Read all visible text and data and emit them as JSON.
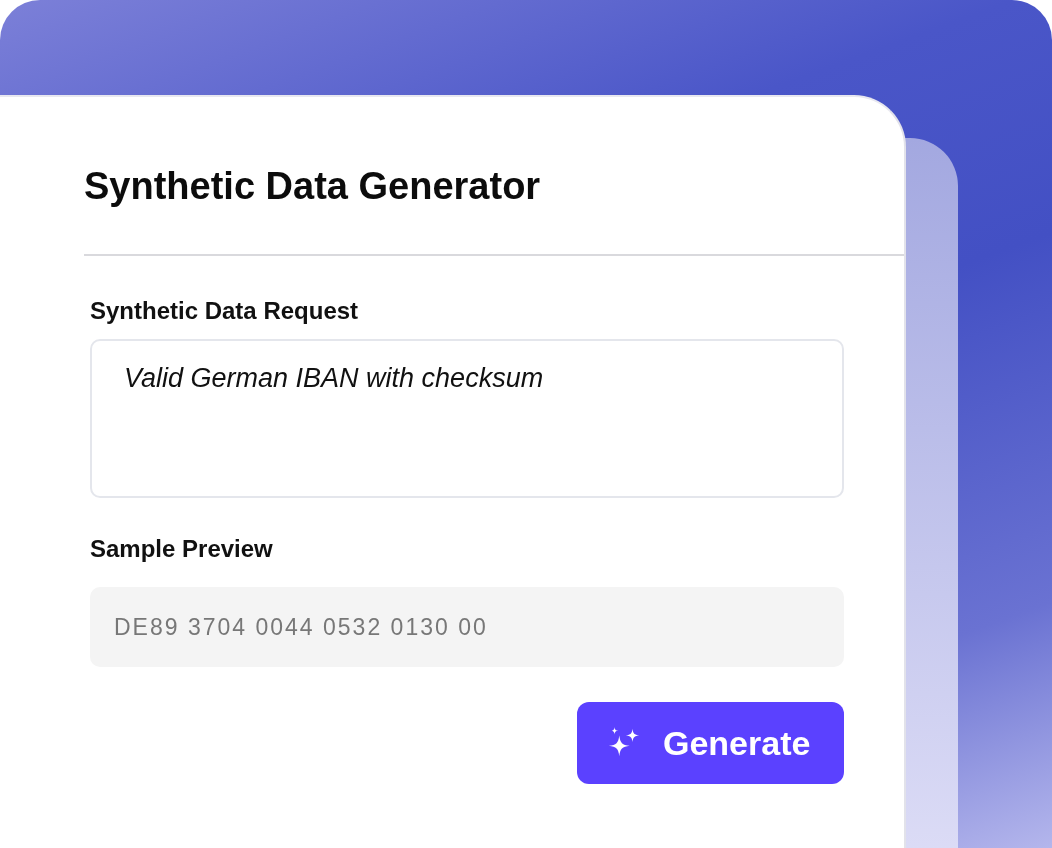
{
  "app": {
    "title": "Synthetic Data Generator"
  },
  "request": {
    "label": "Synthetic Data Request",
    "value": "Valid German IBAN with checksum"
  },
  "preview": {
    "label": "Sample Preview",
    "value": "DE89 3704 0044 0532 0130 00"
  },
  "generate_button": {
    "label": "Generate"
  }
}
